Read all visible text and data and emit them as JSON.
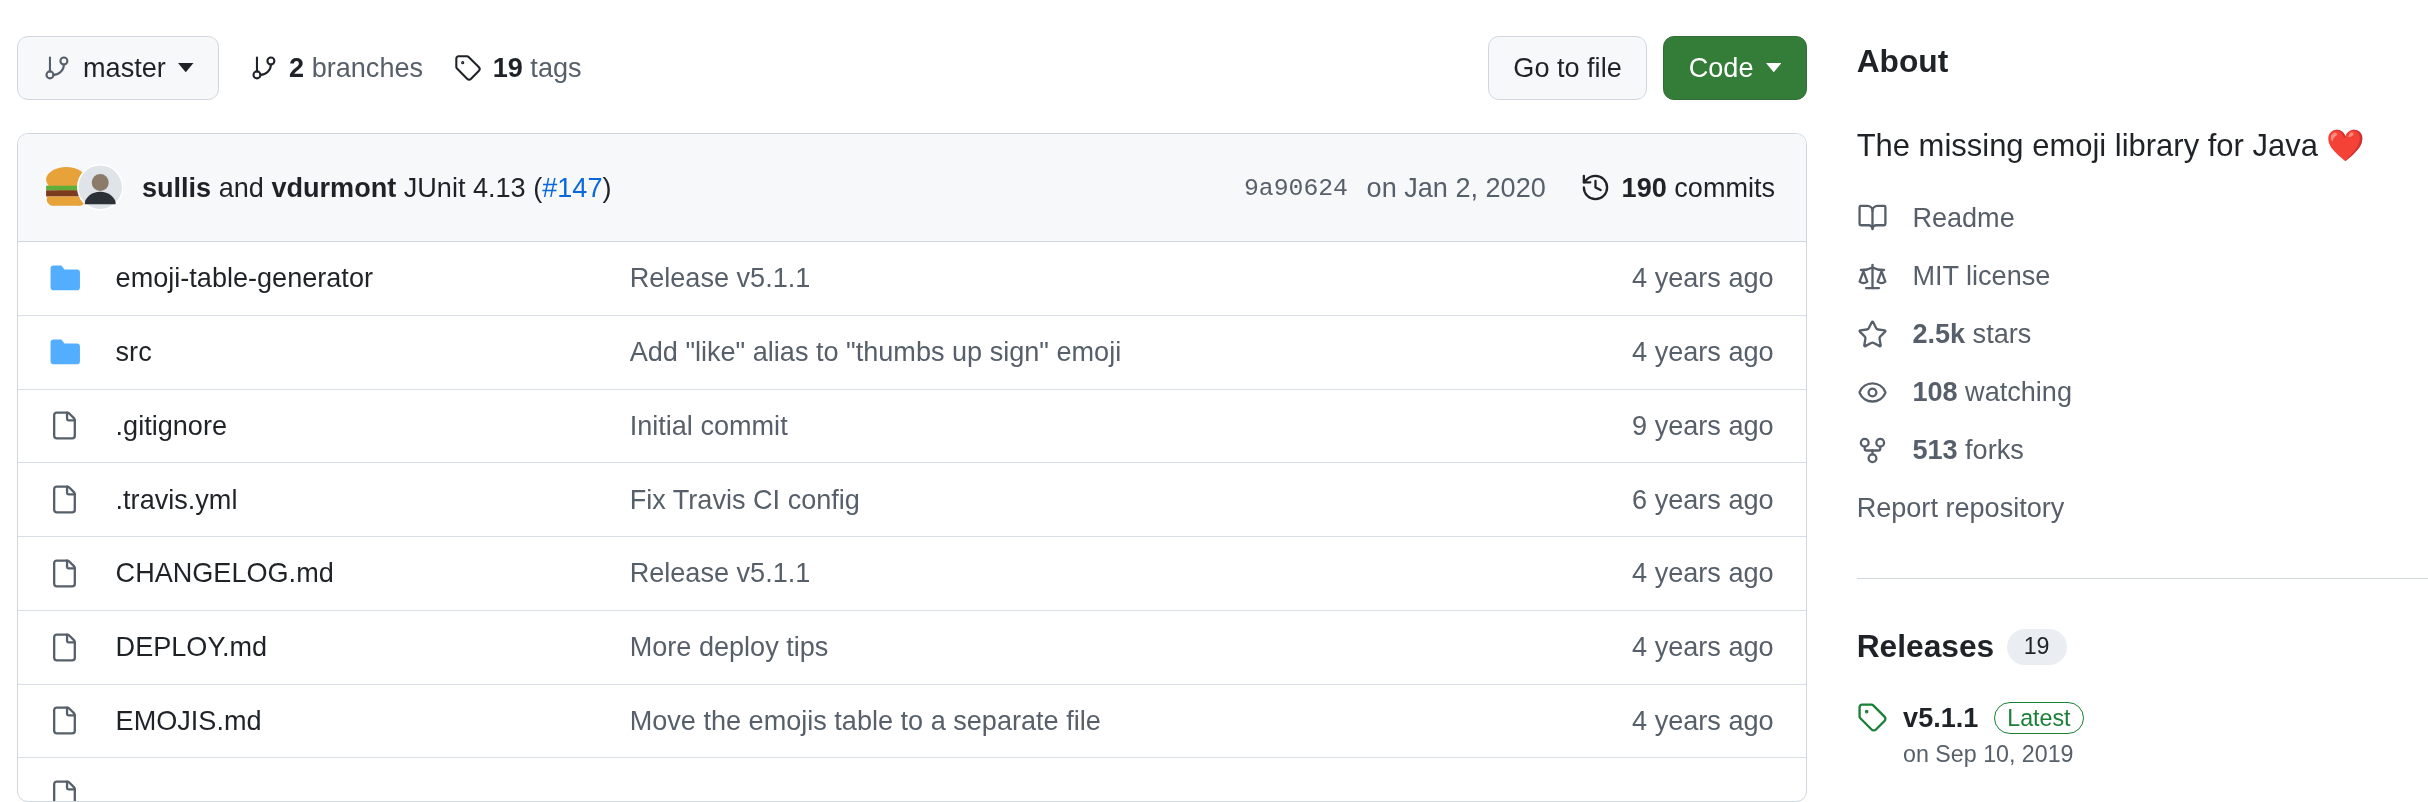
{
  "toolbar": {
    "branch": "master",
    "branches": "**2** branches",
    "tags": "**19** tags",
    "go_to_file": "Go to file",
    "code": "Code"
  },
  "commit": {
    "authors": "**sullis** and **vdurmont** JUnit 4.13 (",
    "pr_link": "#147",
    "after": ")",
    "hash": "9a90624",
    "date": "on Jan 2, 2020",
    "commits": "**190** commits"
  },
  "files": [
    {
      "kind": "folder",
      "name": "emoji-table-generator",
      "message": "Release v5.1.1",
      "age": "4 years ago"
    },
    {
      "kind": "folder",
      "name": "src",
      "message": "Add \"like\" alias to \"thumbs up sign\" emoji",
      "age": "4 years ago"
    },
    {
      "kind": "file",
      "name": ".gitignore",
      "message": "Initial commit",
      "age": "9 years ago"
    },
    {
      "kind": "file",
      "name": ".travis.yml",
      "message": "Fix Travis CI config",
      "age": "6 years ago"
    },
    {
      "kind": "file",
      "name": "CHANGELOG.md",
      "message": "Release v5.1.1",
      "age": "4 years ago"
    },
    {
      "kind": "file",
      "name": "DEPLOY.md",
      "message": "More deploy tips",
      "age": "4 years ago"
    },
    {
      "kind": "file",
      "name": "EMOJIS.md",
      "message": "Move the emojis table to a separate file",
      "age": "4 years ago"
    },
    {
      "kind": "file"
    }
  ],
  "about": {
    "title": "About",
    "description": "The missing emoji library for Java ❤️",
    "links": [
      {
        "kind": "readme",
        "text": "Readme"
      },
      {
        "kind": "license",
        "text": "MIT license"
      },
      {
        "kind": "stars",
        "text": "**2.5k** stars"
      },
      {
        "kind": "watching",
        "text": "**108** watching"
      },
      {
        "kind": "forks",
        "text": "**513** forks"
      }
    ],
    "report": "Report repository"
  },
  "releases": {
    "title": "Releases",
    "count": "19",
    "latest": {
      "version": "v5.1.1",
      "badge": "Latest",
      "date": "on Sep 10, 2019"
    }
  }
}
